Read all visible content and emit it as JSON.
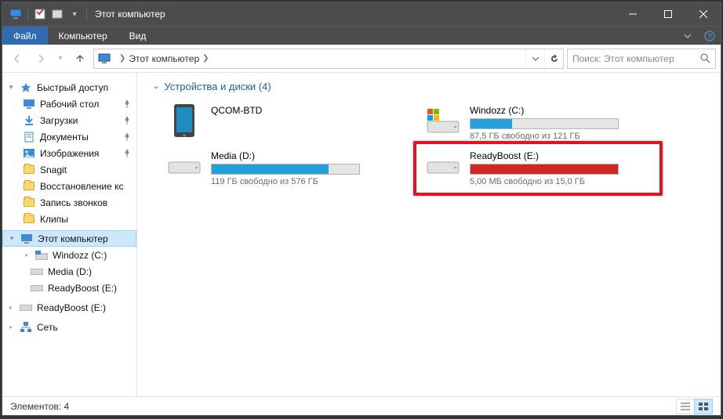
{
  "titlebar": {
    "title": "Этот компьютер"
  },
  "menu": {
    "file": "Файл",
    "computer": "Компьютер",
    "view": "Вид"
  },
  "address": {
    "crumb": "Этот компьютер",
    "search_placeholder": "Поиск: Этот компьютер"
  },
  "sidebar": {
    "quick_access": "Быстрый доступ",
    "items": [
      {
        "label": "Рабочий стол",
        "pinned": true,
        "icon": "desktop"
      },
      {
        "label": "Загрузки",
        "pinned": true,
        "icon": "downloads"
      },
      {
        "label": "Документы",
        "pinned": true,
        "icon": "documents"
      },
      {
        "label": "Изображения",
        "pinned": true,
        "icon": "pictures"
      },
      {
        "label": "Snagit",
        "pinned": false,
        "icon": "folder"
      },
      {
        "label": "Восстановление кс",
        "pinned": false,
        "icon": "folder"
      },
      {
        "label": "Запись звонков",
        "pinned": false,
        "icon": "folder"
      },
      {
        "label": "Клипы",
        "pinned": false,
        "icon": "folder"
      }
    ],
    "this_pc": "Этот компьютер",
    "drives": [
      {
        "label": "Windozz (C:)"
      },
      {
        "label": "Media (D:)"
      },
      {
        "label": "ReadyBoost (E:)"
      }
    ],
    "readyboost_alt": "ReadyBoost (E:)",
    "network": "Сеть"
  },
  "content": {
    "section_title": "Устройства и диски (4)",
    "devices": [
      {
        "name": "QCOM-BTD",
        "type": "phone"
      },
      {
        "name": "Windozz (C:)",
        "type": "os-drive",
        "bar_pct": 28,
        "bar_color": "#26a0da",
        "text": "87,5 ГБ свободно из 121 ГБ"
      },
      {
        "name": "Media (D:)",
        "type": "drive",
        "bar_pct": 79,
        "bar_color": "#26a0da",
        "text": "119 ГБ свободно из 576 ГБ"
      },
      {
        "name": "ReadyBoost (E:)",
        "type": "drive",
        "bar_pct": 100,
        "bar_color": "#d12626",
        "text": "5,00 МБ свободно из 15,0 ГБ",
        "highlight": true
      }
    ]
  },
  "status": {
    "text": "Элементов: 4"
  }
}
